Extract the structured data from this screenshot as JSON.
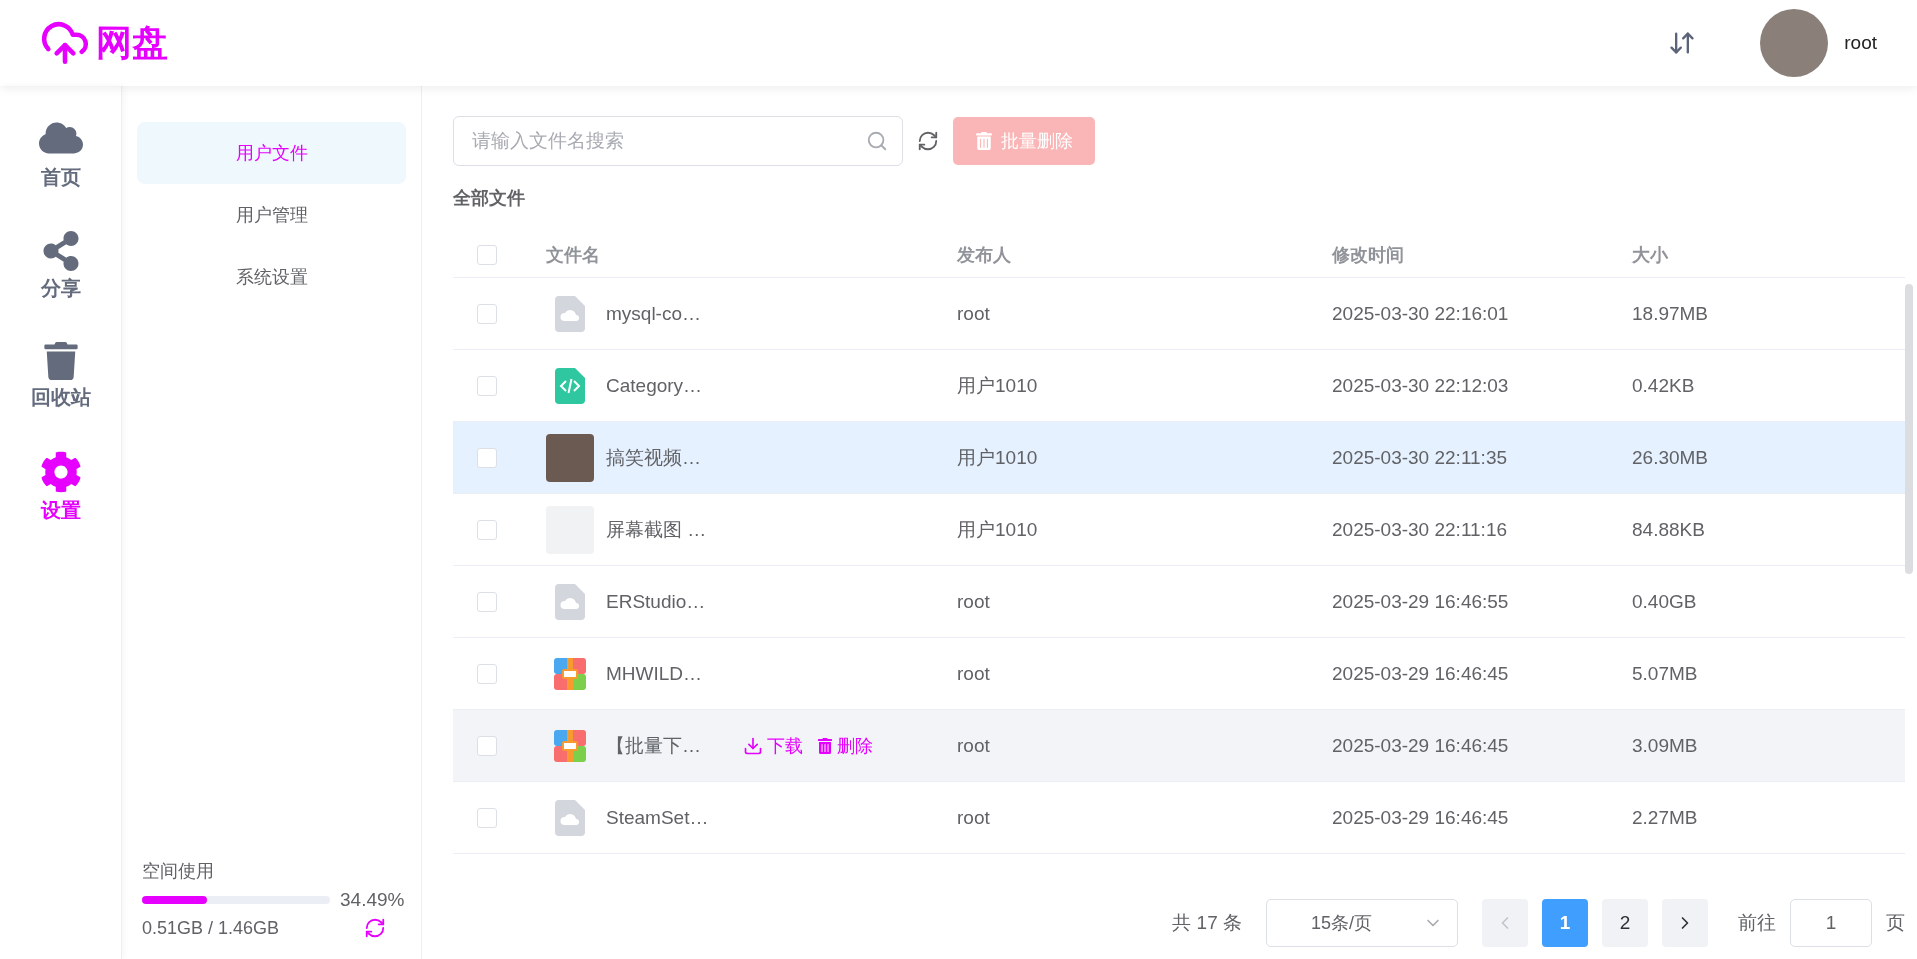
{
  "header": {
    "logo": "网盘",
    "user": "root"
  },
  "nav": [
    {
      "kind": "home",
      "label": "首页",
      "selected": false
    },
    {
      "kind": "share",
      "label": "分享",
      "selected": false
    },
    {
      "kind": "trash",
      "label": "回收站",
      "selected": false
    },
    {
      "kind": "settings",
      "label": "设置",
      "selected": true
    }
  ],
  "submenu": [
    {
      "label": "用户文件",
      "selected": true
    },
    {
      "label": "用户管理",
      "selected": false
    },
    {
      "label": "系统设置",
      "selected": false
    }
  ],
  "storage": {
    "label": "空间使用",
    "level": 0.3449,
    "percent": "34.49%",
    "usage": "0.51GB / 1.46GB"
  },
  "toolbar": {
    "search_placeholder": "请输入文件名搜索",
    "batch_delete": {
      "label": "批量删除",
      "disabled": true
    }
  },
  "breadcrumb": "全部文件",
  "table": {
    "all_checked": false,
    "columns": [
      "文件名",
      "发布人",
      "修改时间",
      "大小"
    ],
    "rows": [
      {
        "kind": "cloud",
        "name": "mysql-co…",
        "publisher": "root",
        "modified": "2025-03-30 22:16:01",
        "size": "18.97MB",
        "checked": false,
        "selected": false
      },
      {
        "kind": "code",
        "name": "Category…",
        "publisher": "用户1010",
        "modified": "2025-03-30 22:12:03",
        "size": "0.42KB",
        "checked": false,
        "selected": false
      },
      {
        "kind": "video",
        "name": "搞笑视频…",
        "publisher": "用户1010",
        "modified": "2025-03-30 22:11:35",
        "size": "26.30MB",
        "checked": false,
        "selected": true
      },
      {
        "kind": "image",
        "name": "屏幕截图 …",
        "publisher": "用户1010",
        "modified": "2025-03-30 22:11:16",
        "size": "84.88KB",
        "checked": false,
        "selected": false
      },
      {
        "kind": "cloud",
        "name": "ERStudio…",
        "publisher": "root",
        "modified": "2025-03-29 16:46:55",
        "size": "0.40GB",
        "checked": false,
        "selected": false
      },
      {
        "kind": "archive",
        "name": "MHWILD…",
        "publisher": "root",
        "modified": "2025-03-29 16:46:45",
        "size": "5.07MB",
        "checked": false,
        "selected": false
      },
      {
        "kind": "archive",
        "name": "【批量下…",
        "publisher": "root",
        "modified": "2025-03-29 16:46:45",
        "size": "3.09MB",
        "checked": false,
        "selected": false,
        "actions": [
          {
            "kind": "download",
            "label": "下载"
          },
          {
            "kind": "delete",
            "label": "删除"
          }
        ]
      },
      {
        "kind": "cloud",
        "name": "SteamSet…",
        "publisher": "root",
        "modified": "2025-03-29 16:46:45",
        "size": "2.27MB",
        "checked": false,
        "selected": false
      }
    ]
  },
  "pagination": {
    "total": "共 17 条",
    "page_size": "15条/页",
    "prev_disabled": true,
    "next_disabled": false,
    "pages": [
      {
        "label": "1",
        "selected": true
      },
      {
        "label": "2",
        "selected": false
      }
    ],
    "goto_label": "前往",
    "goto_value": "1",
    "goto_suffix": "页"
  }
}
